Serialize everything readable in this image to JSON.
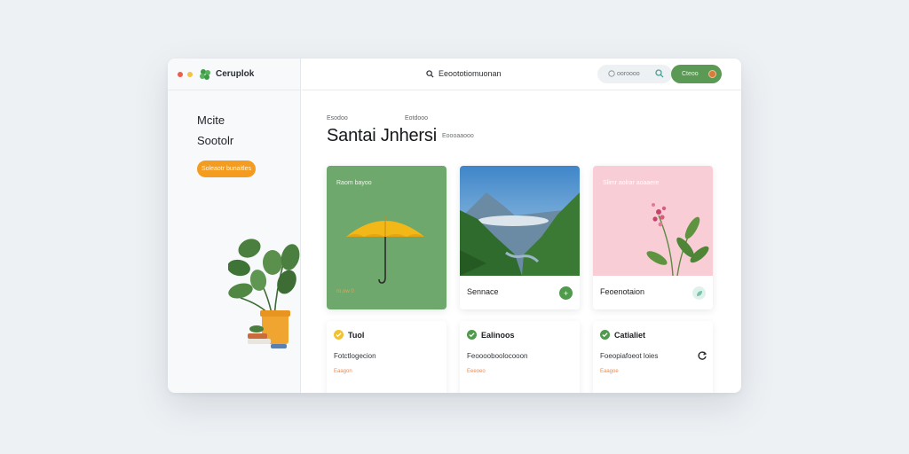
{
  "app": {
    "brand": "Ceruplok"
  },
  "colors": {
    "accent_green": "#5a9a55",
    "accent_orange": "#f39c1f",
    "card_green": "#6fa86c",
    "card_pink": "#f9cdd6"
  },
  "window_controls": [
    "close",
    "minimize"
  ],
  "sidebar": {
    "items": [
      {
        "label": "Mcite"
      },
      {
        "label": "Sootolr"
      }
    ],
    "cta_label": "Soleaotr bunaitles"
  },
  "topbar": {
    "center_search_label": "Eeoototiomuonan",
    "search_pill_placeholder": "ooroooo",
    "user_pill_label": "Cteoo"
  },
  "header": {
    "eyebrow_left": "Esodoo",
    "eyebrow_right": "Eotdooo",
    "title": "Santai Jnhersi",
    "title_side": "Eoooaaooo"
  },
  "cards": [
    {
      "overlay_label": "Raom bayoo",
      "footer_label": "ro.ow 0",
      "icon": "umbrella-illustration"
    },
    {
      "title": "Sennace",
      "icon": "mountain-landscape",
      "action_icon": "plus-icon"
    },
    {
      "overlay_label": "Slimr aolrar aoaaere",
      "title": "Feoenotaion",
      "icon": "flower-illustration",
      "action_icon": "leaf-icon"
    }
  ],
  "info_cards": [
    {
      "heading": "Tuol",
      "line": "Fotctlogecion",
      "sub": "Eaagon",
      "check_color": "#f2c230"
    },
    {
      "heading": "Ealinoos",
      "line": "Feooooboolocooon",
      "sub": "Eeeoeo",
      "check_color": "#4f9a4b"
    },
    {
      "heading": "Catialiet",
      "line": "Foeopiafoeot loies",
      "sub": "Eaagoe",
      "check_color": "#4f9a4b"
    }
  ]
}
